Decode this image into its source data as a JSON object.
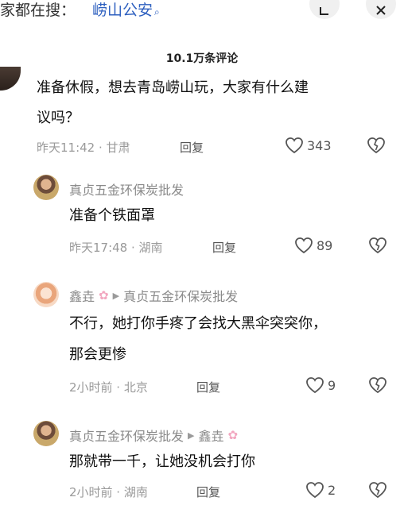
{
  "search": {
    "prefix": "家都在搜：",
    "query": "崂山公安"
  },
  "comments_count_title": "10.1万条评论",
  "main_comment": {
    "text_line1": "准备休假，想去青岛崂山玩，大家有什么建",
    "text_line2": "议吗？",
    "time_location": "昨天11:42 · 甘肃",
    "reply_label": "回复",
    "likes": "343"
  },
  "replies": [
    {
      "username": "真贞五金环保炭批发",
      "text": "准备个铁面罩",
      "time_location": "昨天17:48 · 湖南",
      "reply_label": "回复",
      "likes": "89"
    },
    {
      "username": "鑫垚",
      "reply_to": "真贞五金环保炭批发",
      "text_line1": "不行，她打你手疼了会找大黑伞突突你，",
      "text_line2": "那会更惨",
      "time_location": "2小时前 · 北京",
      "reply_label": "回复",
      "likes": "9"
    },
    {
      "username": "真贞五金环保炭批发",
      "reply_to": "鑫垚",
      "text": "那就带一千，让她没机会打你",
      "time_location": "2小时前 · 湖南",
      "reply_label": "回复",
      "likes": "2"
    }
  ],
  "icons": {
    "search": "magnifier-icon",
    "share": "share-icon",
    "close": "close-icon",
    "like": "heart-icon",
    "dislike": "broken-heart-icon",
    "flower": "flower-icon",
    "reply_arrow": "play-arrow-icon"
  },
  "colors": {
    "link": "#2d5fbf",
    "muted": "#9a9a9a",
    "flower": "#f2a7c0"
  }
}
